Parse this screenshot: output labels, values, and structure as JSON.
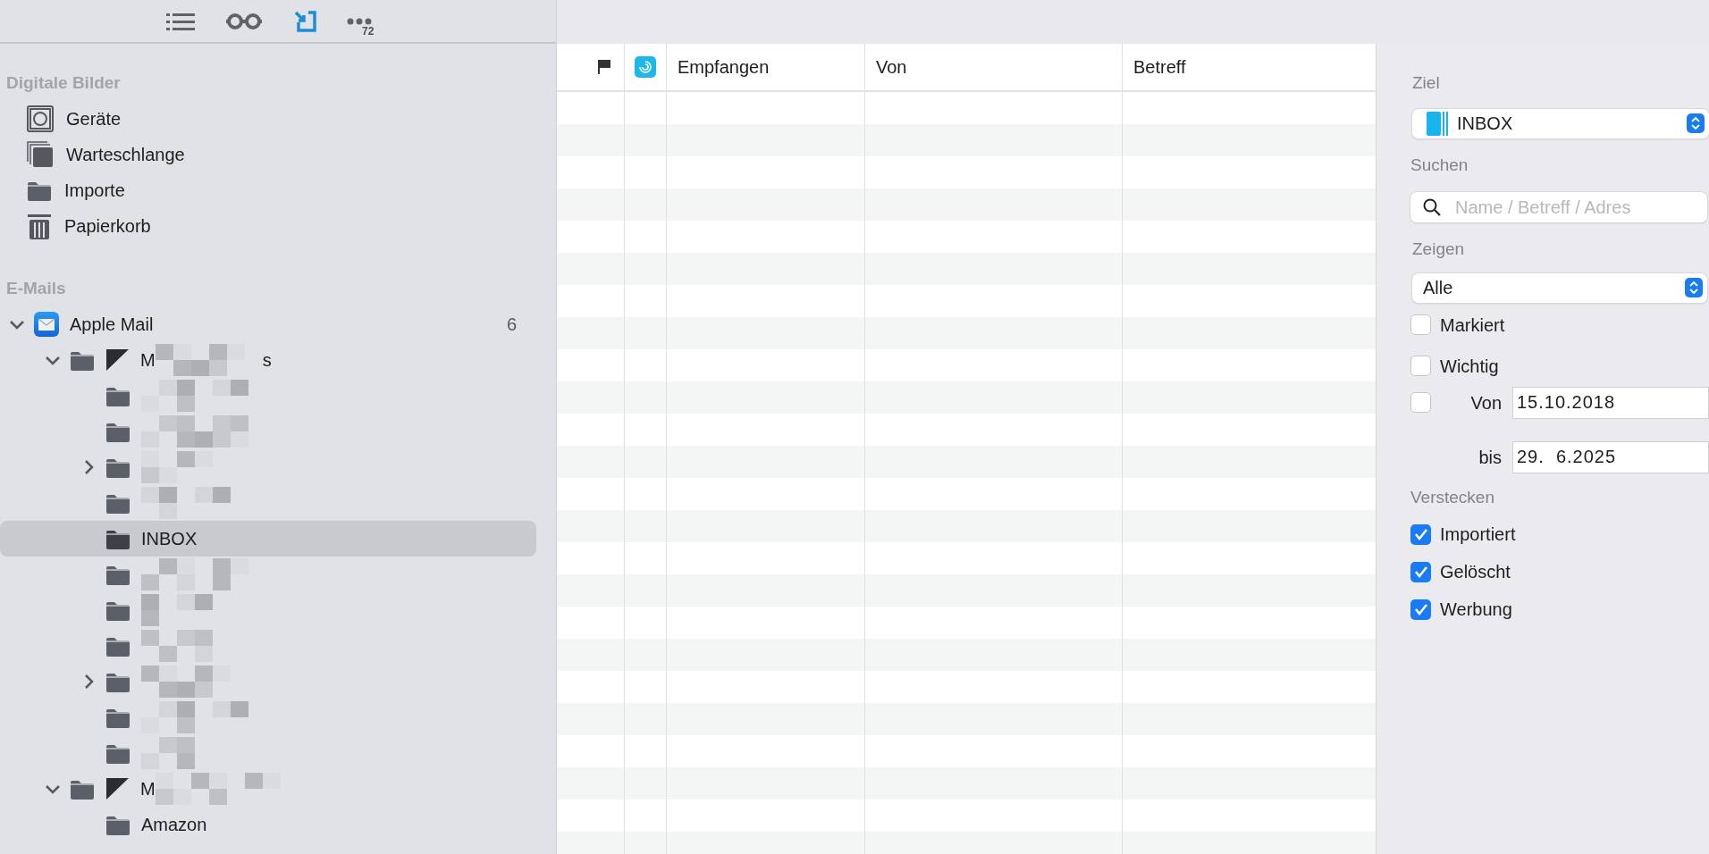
{
  "toolbar": {
    "items": [
      {
        "kind": "list",
        "selected": false
      },
      {
        "kind": "glasses",
        "selected": false
      },
      {
        "kind": "import",
        "selected": true
      },
      {
        "kind": "more",
        "badge": "72",
        "selected": false
      }
    ]
  },
  "sidebar": {
    "sections": [
      {
        "title": "Digitale Bilder",
        "items": [
          {
            "kind": "device",
            "label": "Geräte",
            "selected": false
          },
          {
            "kind": "stack",
            "label": "Warteschlange",
            "selected": false
          },
          {
            "kind": "folder",
            "label": "Importe",
            "selected": false
          },
          {
            "kind": "trash",
            "label": "Papierkorb",
            "selected": false
          }
        ]
      },
      {
        "title": "E-Mails",
        "tree": [
          {
            "kind": "mail",
            "label": "Apple Mail",
            "count": "6",
            "expanded": true,
            "selected": false,
            "children": [
              {
                "kind": "account",
                "label": "M",
                "label_end": "s",
                "redacted": true,
                "expanded": true,
                "selected": false,
                "children": [
                  {
                    "kind": "folder",
                    "redacted": true,
                    "selected": false
                  },
                  {
                    "kind": "folder",
                    "redacted": true,
                    "selected": false
                  },
                  {
                    "kind": "folder",
                    "redacted": true,
                    "expanded": false,
                    "selected": false
                  },
                  {
                    "kind": "folder",
                    "redacted": true,
                    "selected": false
                  },
                  {
                    "kind": "folder",
                    "label": "INBOX",
                    "selected": true
                  },
                  {
                    "kind": "folder",
                    "redacted": true,
                    "selected": false
                  },
                  {
                    "kind": "folder",
                    "redacted": true,
                    "selected": false
                  },
                  {
                    "kind": "folder",
                    "redacted": true,
                    "selected": false
                  },
                  {
                    "kind": "folder",
                    "redacted": true,
                    "expanded": false,
                    "selected": false
                  },
                  {
                    "kind": "folder",
                    "redacted": true,
                    "selected": false
                  },
                  {
                    "kind": "folder",
                    "redacted": true,
                    "selected": false
                  }
                ]
              },
              {
                "kind": "account",
                "label": "M",
                "redacted": true,
                "expanded": true,
                "selected": false,
                "children": [
                  {
                    "kind": "folder",
                    "label": "Amazon",
                    "selected": false
                  }
                ]
              }
            ]
          }
        ]
      }
    ]
  },
  "table": {
    "columns": [
      {
        "kind": "flag"
      },
      {
        "kind": "app"
      },
      {
        "kind": "text",
        "label": "Empfangen"
      },
      {
        "kind": "text",
        "label": "Von"
      },
      {
        "kind": "text",
        "label": "Betreff"
      }
    ]
  },
  "filters": {
    "target_label": "Ziel",
    "target_value": "INBOX",
    "search_label": "Suchen",
    "search_placeholder": "Name / Betreff / Adres",
    "show_label": "Zeigen",
    "show_value": "Alle",
    "options": [
      {
        "label": "Markiert",
        "checked": false
      },
      {
        "label": "Wichtig",
        "checked": false
      }
    ],
    "date_range": {
      "checked": false,
      "from_label": "Von",
      "from_value": "15.10.2018",
      "to_label": "bis",
      "to_value": "29.  6.2025"
    },
    "hide_label": "Verstecken",
    "hide_options": [
      {
        "label": "Importiert",
        "checked": true
      },
      {
        "label": "Gelöscht",
        "checked": true
      },
      {
        "label": "Werbung",
        "checked": true
      }
    ]
  }
}
